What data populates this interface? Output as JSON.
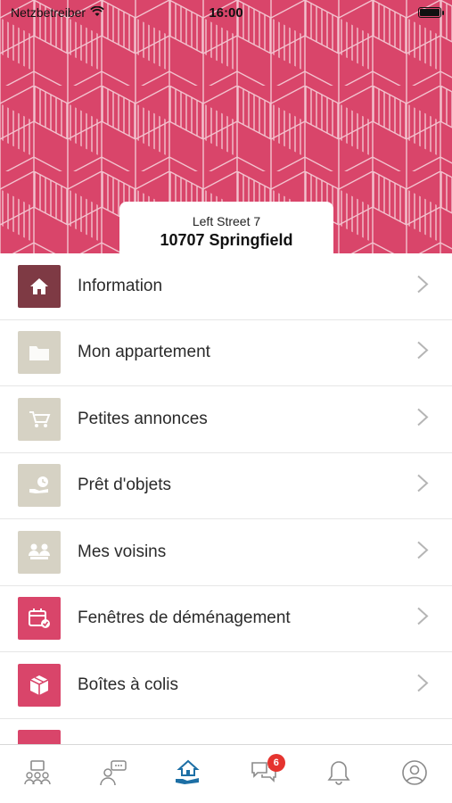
{
  "status_bar": {
    "carrier": "Netzbetreiber",
    "time": "16:00"
  },
  "colors": {
    "accent": "#d9456a",
    "accent_dark": "#7e3a44",
    "tile_muted": "#d6d2c4",
    "icon_gray": "#8a8a8a",
    "tab_active": "#1d6fa5"
  },
  "address": {
    "street": "Left Street 7",
    "city": "10707 Springfield"
  },
  "menu": {
    "items": [
      {
        "label": "Information",
        "icon": "home-icon"
      },
      {
        "label": "Mon appartement",
        "icon": "folder-icon"
      },
      {
        "label": "Petites annonces",
        "icon": "shopping-cart-icon"
      },
      {
        "label": "Prêt d'objets",
        "icon": "lending-hand-icon"
      },
      {
        "label": "Mes voisins",
        "icon": "neighbors-icon"
      },
      {
        "label": "Fenêtres de déménagement",
        "icon": "calendar-check-icon"
      },
      {
        "label": "Boîtes à colis",
        "icon": "parcel-box-icon"
      }
    ]
  },
  "tab_bar": {
    "tabs": [
      {
        "icon": "community-icon"
      },
      {
        "icon": "chat-person-icon"
      },
      {
        "icon": "home-hand-icon",
        "active": true
      },
      {
        "icon": "messages-icon",
        "badge": "6"
      },
      {
        "icon": "bell-icon"
      },
      {
        "icon": "profile-icon"
      }
    ]
  }
}
